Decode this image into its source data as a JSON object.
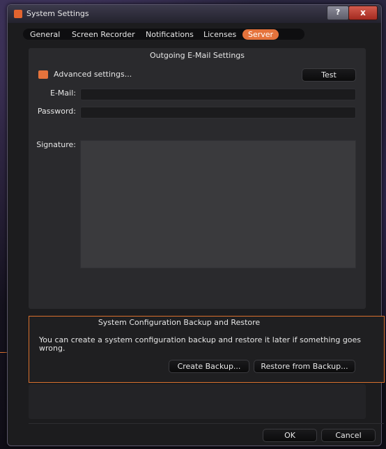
{
  "window": {
    "title": "System Settings",
    "help_label": "?",
    "close_label": "x"
  },
  "tabs": [
    {
      "label": "General"
    },
    {
      "label": "Screen Recorder"
    },
    {
      "label": "Notifications"
    },
    {
      "label": "Licenses"
    },
    {
      "label": "Server",
      "active": true
    }
  ],
  "email_section": {
    "title": "Outgoing E-Mail Settings",
    "advanced_label": "Advanced settings...",
    "test_label": "Test",
    "email_label": "E-Mail:",
    "email_value": "",
    "password_label": "Password:",
    "password_value": "",
    "signature_label": "Signature:",
    "signature_value": ""
  },
  "backup_section": {
    "title": "System Configuration Backup and Restore",
    "description": "You can create a system configuration backup and restore it later if something goes wrong.",
    "create_label": "Create Backup...",
    "restore_label": "Restore from Backup..."
  },
  "footer": {
    "ok_label": "OK",
    "cancel_label": "Cancel"
  },
  "colors": {
    "accent": "#e5733c",
    "highlight_border": "#d9702e"
  }
}
